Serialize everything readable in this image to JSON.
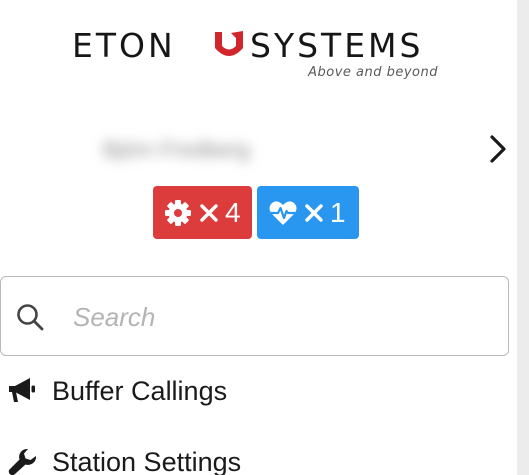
{
  "logo": {
    "word_left": "ETON",
    "word_right": "SYSTEMS",
    "tagline": "Above and beyond",
    "mark_color": "#d0262c"
  },
  "user": {
    "name": "Björn Fredberg"
  },
  "badges": {
    "settings": {
      "icon": "gear-icon",
      "count": "4",
      "color": "#dc3c3b"
    },
    "health": {
      "icon": "heartbeat-icon",
      "count": "1",
      "color": "#2996f0"
    }
  },
  "search": {
    "placeholder": "Search",
    "value": ""
  },
  "menu": {
    "items": [
      {
        "label": "Buffer Callings",
        "icon": "megaphone-icon"
      },
      {
        "label": "Station Settings",
        "icon": "wrench-icon"
      }
    ]
  }
}
